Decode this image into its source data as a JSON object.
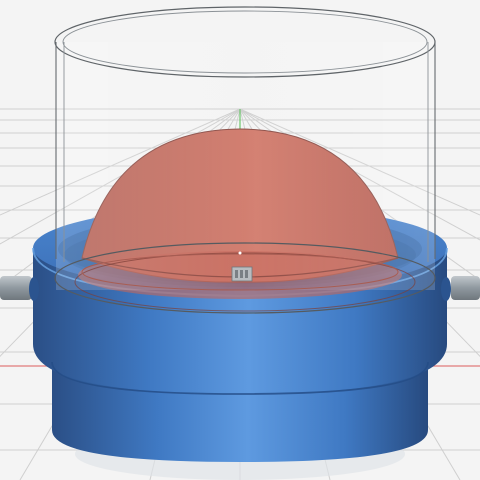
{
  "viewport": {
    "background": "#f4f4f4",
    "grid_color": "#c9c9c9",
    "axis_x_color": "#e07b7b",
    "axis_y_color": "#66c266"
  },
  "model": {
    "cylinder_color": "#eaf3f8",
    "dome_color": "#c96d5e",
    "base_color": "#3f79c3",
    "base_dark": "#2f5e9f",
    "rod_color": "#9aa3a9"
  },
  "icons": {
    "origin_marker": "origin-marker-icon"
  }
}
